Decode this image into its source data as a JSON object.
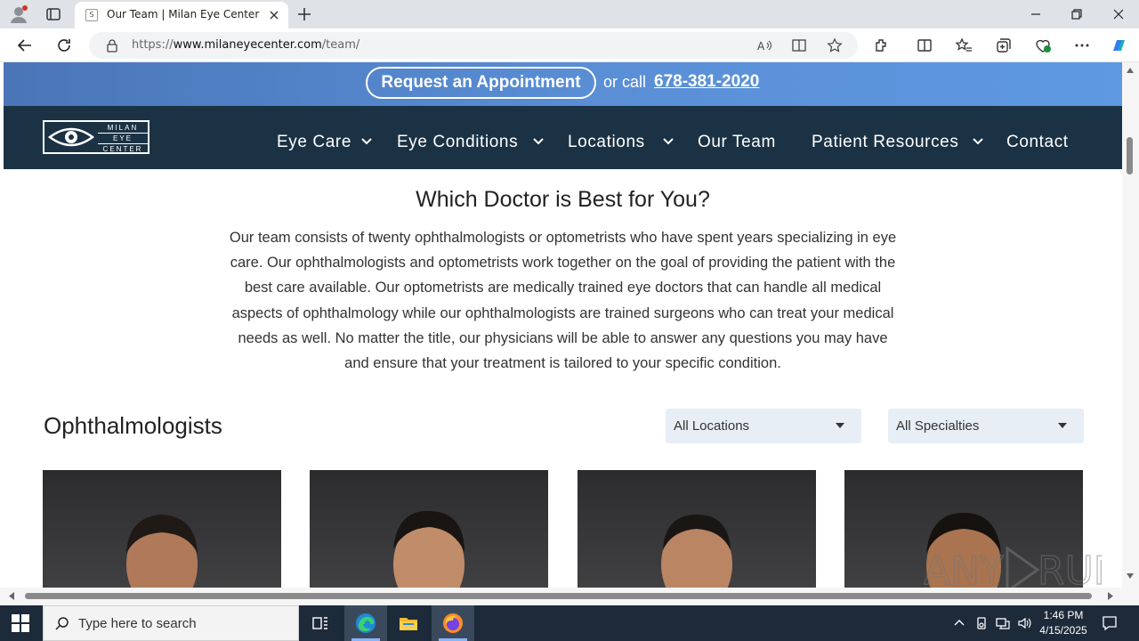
{
  "browser": {
    "tab_title": "Our Team | Milan Eye Center",
    "tab_favicon": "S",
    "url_prefix": "https://",
    "url_host": "www.milaneyecenter.com",
    "url_path": "/team/"
  },
  "promo": {
    "appointment_label": "Request an Appointment",
    "or_call": "or call",
    "phone": "678-381-2020"
  },
  "logo": {
    "line1": "MILAN",
    "line2": "EYE",
    "line3": "CENTER"
  },
  "nav": {
    "eye_care": "Eye Care",
    "eye_conditions": "Eye Conditions",
    "locations": "Locations",
    "our_team": "Our Team",
    "patient_resources": "Patient Resources",
    "contact": "Contact"
  },
  "content": {
    "heading": "Which Doctor is Best for You?",
    "intro": "Our team consists of twenty ophthalmologists or optometrists who have spent years specializing in eye care. Our ophthalmologists and optometrists work together on the goal of providing the patient with the best care available. Our optometrists are medically trained eye doctors that can handle all medical aspects of ophthalmology while our ophthalmologists are trained surgeons who can treat your medical needs as well. No matter the title, our physicians will be able to answer any questions you may have and ensure that your treatment is tailored to your specific condition.",
    "section": "Ophthalmologists",
    "filter_locations": "All Locations",
    "filter_specialties": "All Specialties"
  },
  "watermark": "ANY.RUN",
  "taskbar": {
    "search_placeholder": "Type here to search",
    "time": "1:46 PM",
    "date": "4/15/2025"
  },
  "colors": {
    "nav_bg": "#1b3245",
    "promo_bg": "#5a8fd6",
    "taskbar_bg": "#1d2a3a"
  }
}
